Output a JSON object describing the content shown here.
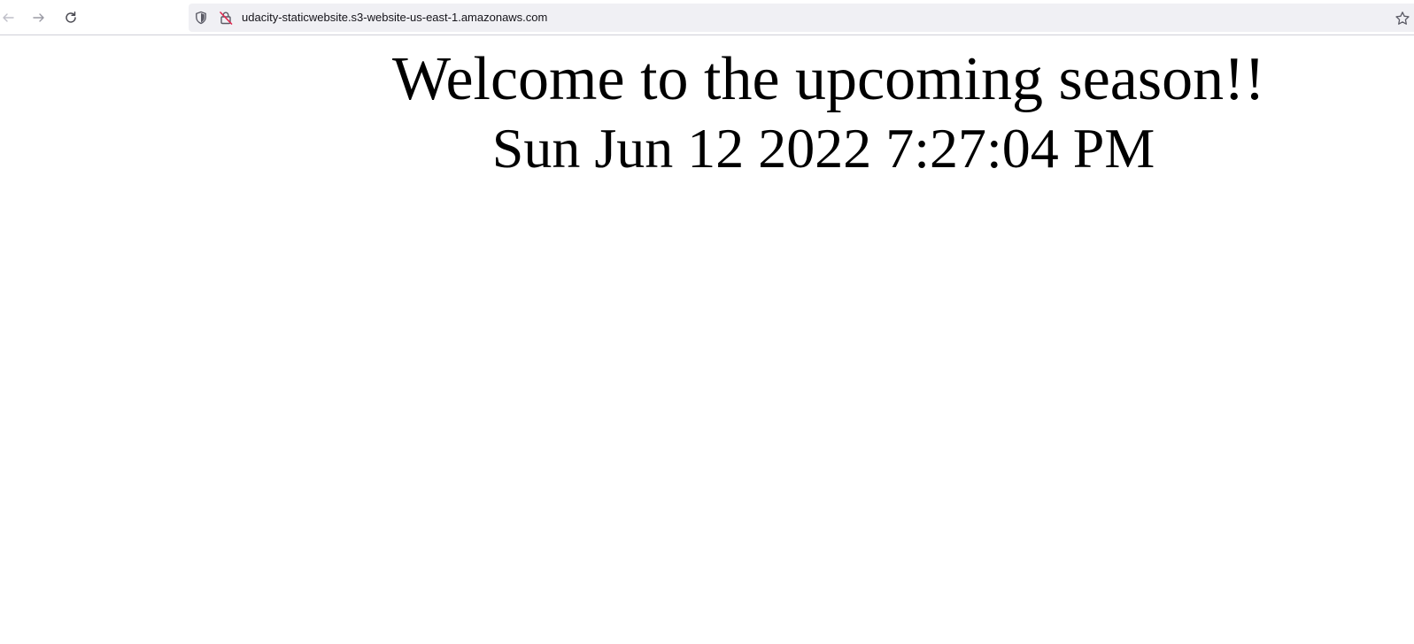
{
  "browser": {
    "url": "udacity-staticwebsite.s3-website-us-east-1.amazonaws.com",
    "icons": {
      "back": "arrow-left-icon",
      "forward": "arrow-right-icon",
      "reload": "reload-icon",
      "tracking": "shield-icon",
      "connection": "insecure-lock-icon",
      "bookmark": "star-icon"
    },
    "colors": {
      "urlbar_bg": "#f0f0f4",
      "insecure_lock": "#e22850"
    }
  },
  "page": {
    "headline": "Welcome to the upcoming season!!",
    "datetime": "Sun Jun 12 2022 7:27:04 PM"
  }
}
